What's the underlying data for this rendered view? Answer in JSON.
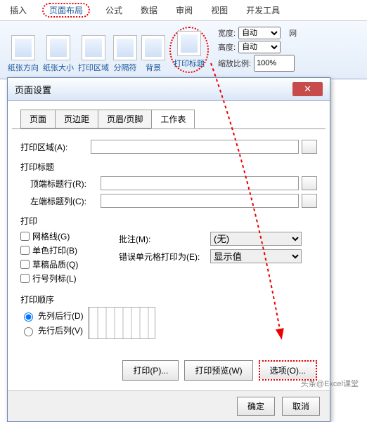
{
  "ribbon": {
    "tabs": [
      "插入",
      "页面布局",
      "公式",
      "数据",
      "审阅",
      "视图",
      "开发工具"
    ]
  },
  "toolbar": {
    "items": [
      "纸张方向",
      "纸张大小",
      "打印区域",
      "分隔符",
      "背景",
      "打印标题"
    ],
    "width_lbl": "宽度:",
    "height_lbl": "高度:",
    "auto": "自动",
    "scale_lbl": "缩放比例:",
    "scale_val": "100%",
    "net_lbl": "网"
  },
  "dialog": {
    "title": "页面设置",
    "tabs": [
      "页面",
      "页边距",
      "页眉/页脚",
      "工作表"
    ],
    "print_area_lbl": "打印区域(A):",
    "print_title_section": "打印标题",
    "top_row_lbl": "顶端标题行(R):",
    "left_col_lbl": "左端标题列(C):",
    "print_section": "打印",
    "chk_grid": "网格线(G)",
    "chk_mono": "单色打印(B)",
    "chk_draft": "草稿品质(Q)",
    "chk_rowcol": "行号列标(L)",
    "note_lbl": "批注(M):",
    "note_val": "(无)",
    "error_lbl": "错误单元格打印为(E):",
    "error_val": "显示值",
    "order_section": "打印顺序",
    "order1": "先列后行(D)",
    "order2": "先行后列(V)",
    "btn_print": "打印(P)...",
    "btn_preview": "打印预览(W)",
    "btn_options": "选项(O)...",
    "btn_ok": "确定",
    "btn_cancel": "取消"
  },
  "watermark": "头条@Excel课堂"
}
